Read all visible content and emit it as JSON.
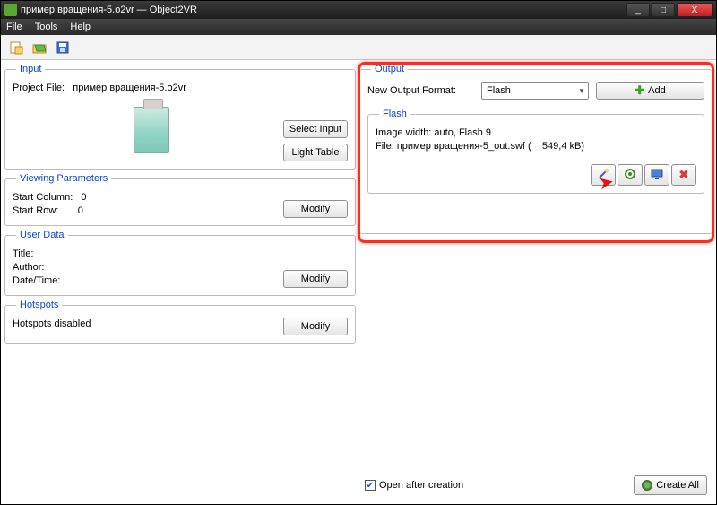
{
  "window": {
    "title": "пример вращения-5.o2vr — Object2VR",
    "min": "_",
    "max": "□",
    "close": "X"
  },
  "menu": {
    "file": "File",
    "tools": "Tools",
    "help": "Help"
  },
  "input": {
    "legend": "Input",
    "project_label": "Project File:",
    "project_value": "пример вращения-5.o2vr",
    "select_btn": "Select Input",
    "light_btn": "Light Table"
  },
  "viewparams": {
    "legend": "Viewing Parameters",
    "startcol_label": "Start Column:",
    "startcol_value": "0",
    "startrow_label": "Start Row:",
    "startrow_value": "0",
    "modify": "Modify"
  },
  "userdata": {
    "legend": "User Data",
    "title_label": "Title:",
    "author_label": "Author:",
    "datetime_label": "Date/Time:",
    "modify": "Modify"
  },
  "hotspots": {
    "legend": "Hotspots",
    "status": "Hotspots disabled",
    "modify": "Modify"
  },
  "output": {
    "legend": "Output",
    "format_label": "New Output Format:",
    "format_value": "Flash",
    "add": "Add",
    "flash": {
      "legend": "Flash",
      "imgwidth": "Image width: auto, Flash 9",
      "file_label": "File: пример вращения-5_out.swf (",
      "file_size": "549,4 kB)"
    }
  },
  "footer": {
    "open_after": "Open after creation",
    "create_all": "Create All"
  }
}
